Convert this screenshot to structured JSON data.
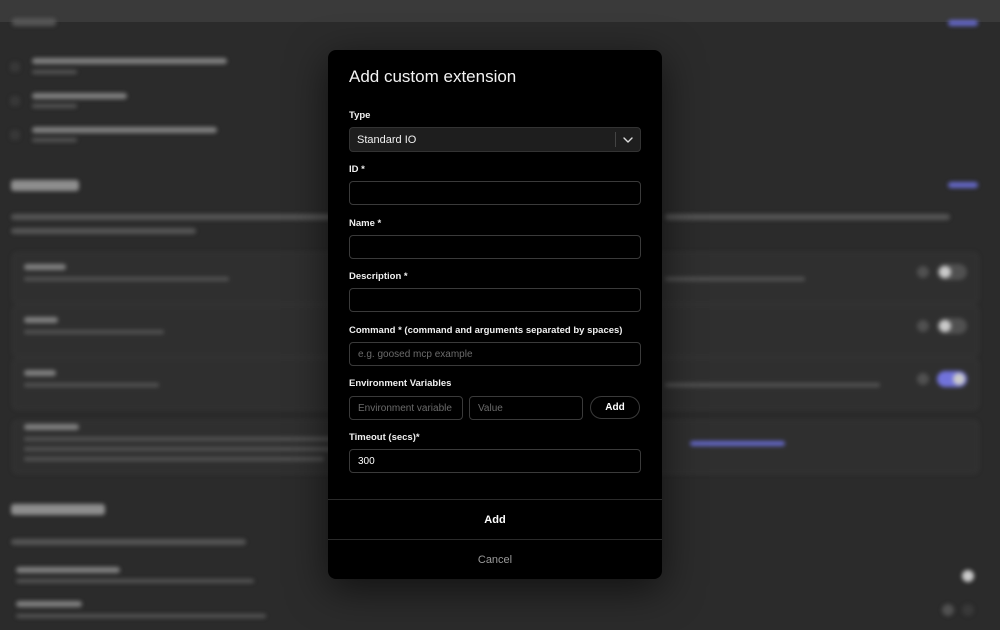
{
  "modal": {
    "title": "Add custom extension",
    "type": {
      "label": "Type",
      "selected": "Standard IO"
    },
    "id": {
      "label": "ID *",
      "value": ""
    },
    "name": {
      "label": "Name *",
      "value": ""
    },
    "description": {
      "label": "Description *",
      "value": ""
    },
    "command": {
      "label": "Command * (command and arguments separated by spaces)",
      "placeholder": "e.g. goosed mcp example",
      "value": ""
    },
    "env": {
      "label": "Environment Variables",
      "name_placeholder": "Environment variable name",
      "value_placeholder": "Value",
      "add_label": "Add"
    },
    "timeout": {
      "label": "Timeout (secs)*",
      "value": "300"
    },
    "add_button": "Add",
    "cancel_button": "Cancel"
  },
  "colors": {
    "modal_bg": "#000000",
    "backdrop": "#2b2b2b",
    "accent": "#7a7cf0"
  }
}
